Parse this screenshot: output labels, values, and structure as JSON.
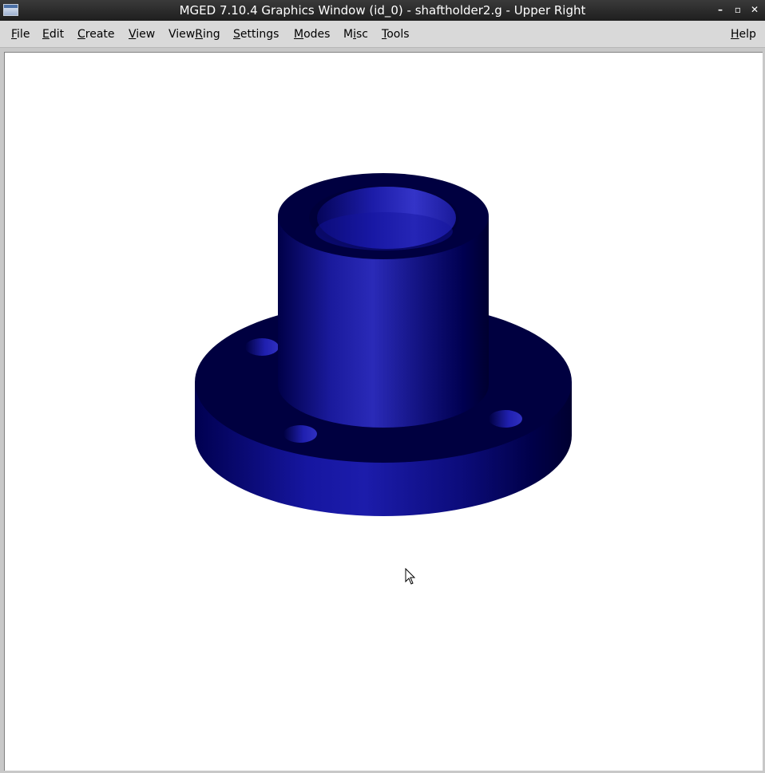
{
  "window": {
    "title": "MGED 7.10.4 Graphics Window (id_0) - shaftholder2.g - Upper Right",
    "controls": {
      "minimize": "–",
      "maximize": "▫",
      "close": "✕"
    }
  },
  "menubar": {
    "items": [
      {
        "pre": "",
        "ul": "F",
        "post": "ile"
      },
      {
        "pre": "",
        "ul": "E",
        "post": "dit"
      },
      {
        "pre": "",
        "ul": "C",
        "post": "reate"
      },
      {
        "pre": "",
        "ul": "V",
        "post": "iew"
      },
      {
        "pre": "View",
        "ul": "R",
        "post": "ing"
      },
      {
        "pre": "",
        "ul": "S",
        "post": "ettings"
      },
      {
        "pre": "",
        "ul": "M",
        "post": "odes"
      },
      {
        "pre": "M",
        "ul": "i",
        "post": "sc"
      },
      {
        "pre": "",
        "ul": "T",
        "post": "ools"
      },
      {
        "pre": "",
        "ul": "H",
        "post": "elp"
      }
    ]
  },
  "viewport": {
    "model": "shaftholder2.g",
    "object_icon": "shaft-holder-3d-model",
    "colors": {
      "dark": "#000040",
      "mid": "#0d0d85",
      "light": "#2a2ab8",
      "background": "#ffffff"
    }
  },
  "icons": {
    "cursor": "mouse-pointer-icon",
    "app": "window-app-icon"
  }
}
